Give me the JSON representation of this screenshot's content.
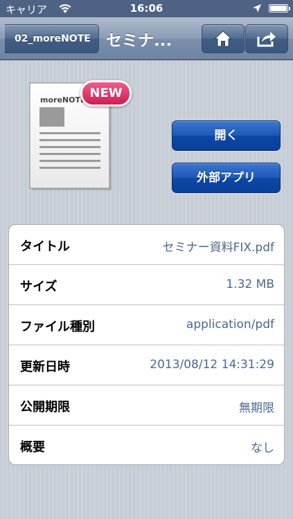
{
  "status_bar": {
    "carrier": "キャリア",
    "time": "16:06"
  },
  "nav": {
    "back_label": "02_moreNOTE",
    "title": "セミナ...",
    "home_icon": "home-icon",
    "share_icon": "share-icon"
  },
  "document": {
    "brand": "moreNOTE",
    "badge": "NEW"
  },
  "actions": {
    "open_label": "開く",
    "external_app_label": "外部アプリ"
  },
  "info": [
    {
      "label": "タイトル",
      "value": "セミナー資料FIX.pdf"
    },
    {
      "label": "サイズ",
      "value": "1.32 MB"
    },
    {
      "label": "ファイル種別",
      "value": "application/pdf"
    },
    {
      "label": "更新日時",
      "value": "2013/08/12 14:31:29"
    },
    {
      "label": "公開期限",
      "value": "無期限"
    },
    {
      "label": "概要",
      "value": "なし"
    }
  ],
  "colors": {
    "accent_blue": "#1d58b7",
    "value_text": "#4a6594",
    "badge_pink": "#d11d52"
  }
}
